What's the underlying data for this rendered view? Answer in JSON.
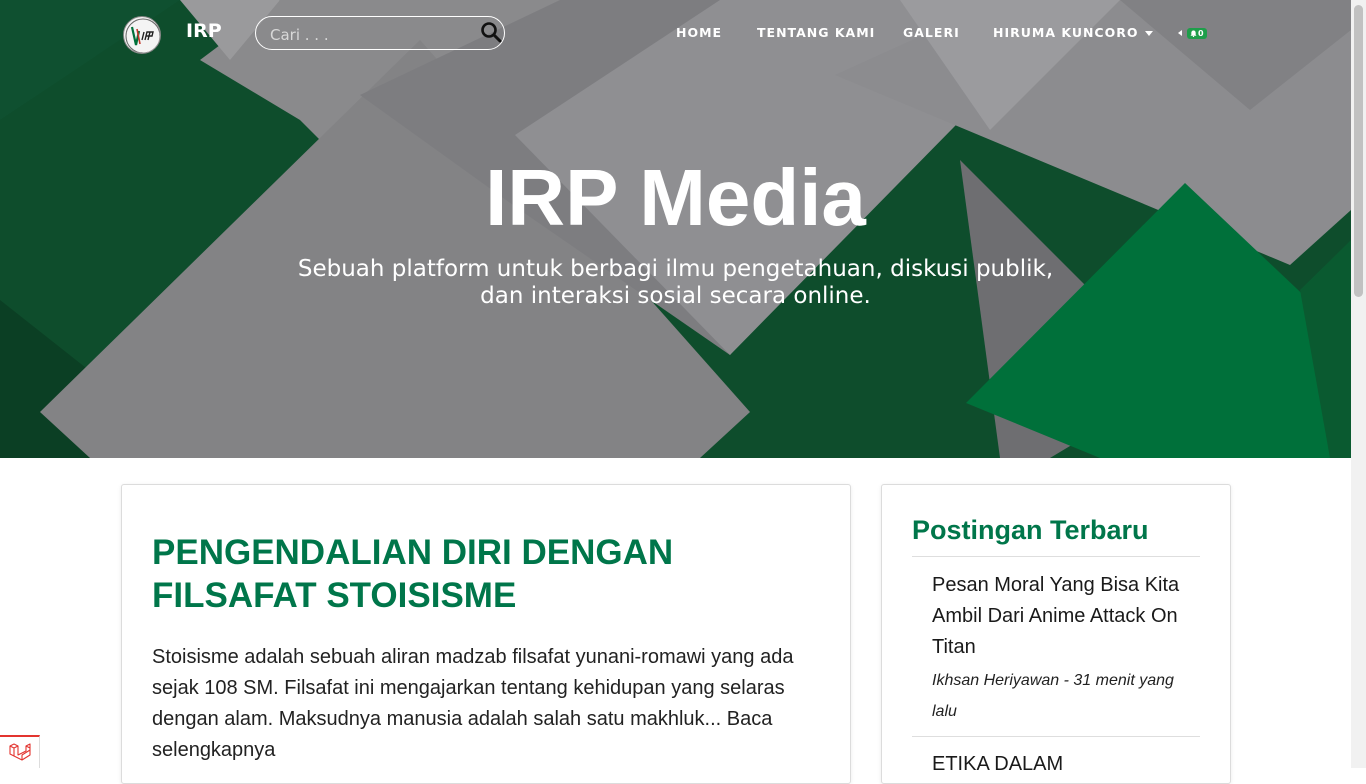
{
  "navbar": {
    "brand": "IRP",
    "search_placeholder": "Cari . . .",
    "links": [
      {
        "label": "HOME"
      },
      {
        "label": "TENTANG KAMI"
      },
      {
        "label": "GALERI"
      },
      {
        "label": "HIRUMA KUNCORO"
      }
    ],
    "notification_count": "0"
  },
  "hero": {
    "title": "IRP Media",
    "subtitle_line1": "Sebuah platform untuk berbagi ilmu pengetahuan, diskusi publik,",
    "subtitle_line2": "dan interaksi sosial secara online."
  },
  "post": {
    "title": "PENGENDALIAN DIRI DENGAN FILSAFAT STOISISME",
    "excerpt": "Stoisisme adalah sebuah aliran madzab filsafat yunani-romawi yang ada sejak 108 SM. Filsafat ini mengajarkan tentang kehidupan yang selaras dengan alam. Maksudnya manusia adalah salah satu makhluk...",
    "read_more": "Baca selengkapnya"
  },
  "sidebar": {
    "title": "Postingan Terbaru",
    "items": [
      {
        "title": "Pesan Moral Yang Bisa Kita Ambil Dari Anime Attack On Titan",
        "meta": "Ikhsan Heriyawan - 31 menit yang lalu"
      },
      {
        "title": "ETIKA DALAM"
      }
    ]
  },
  "colors": {
    "brand_green": "#00764a",
    "hero_dark_green": "#0d4a2b",
    "hero_bright_green": "#00703a",
    "badge_green": "#1e9e4a"
  }
}
